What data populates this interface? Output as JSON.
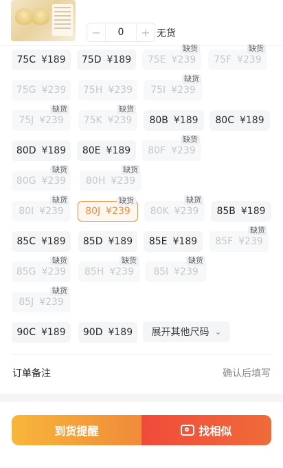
{
  "product": {
    "thumbnail_alt": "product image"
  },
  "quantity": {
    "minus": "−",
    "value": "0",
    "plus": "+",
    "stock_status": "无货"
  },
  "sizes": [
    {
      "size": "75C",
      "price": "¥189",
      "oos": false
    },
    {
      "size": "75D",
      "price": "¥189",
      "oos": false
    },
    {
      "size": "75E",
      "price": "¥239",
      "oos": true,
      "tag": "缺货"
    },
    {
      "size": "75F",
      "price": "¥239",
      "oos": true,
      "tag": "缺货"
    },
    {
      "size": "75G",
      "price": "¥239",
      "oos": true
    },
    {
      "size": "75H",
      "price": "¥239",
      "oos": true
    },
    {
      "size": "75I",
      "price": "¥239",
      "oos": true,
      "tag": "缺货"
    },
    {
      "size": "75J",
      "price": "¥239",
      "oos": true,
      "tag": "缺货"
    },
    {
      "size": "75K",
      "price": "¥239",
      "oos": true,
      "tag": "缺货"
    },
    {
      "size": "80B",
      "price": "¥189",
      "oos": false
    },
    {
      "size": "80C",
      "price": "¥189",
      "oos": false
    },
    {
      "size": "80D",
      "price": "¥189",
      "oos": false
    },
    {
      "size": "80E",
      "price": "¥189",
      "oos": false
    },
    {
      "size": "80F",
      "price": "¥239",
      "oos": true,
      "tag": "缺货"
    },
    {
      "size": "80G",
      "price": "¥239",
      "oos": true,
      "tag": "缺货"
    },
    {
      "size": "80H",
      "price": "¥239",
      "oos": true,
      "tag": "缺货"
    },
    {
      "size": "80I",
      "price": "¥239",
      "oos": true,
      "tag": "缺货"
    },
    {
      "size": "80J",
      "price": "¥239",
      "oos": true,
      "tag": "缺货",
      "selected": true
    },
    {
      "size": "80K",
      "price": "¥239",
      "oos": true,
      "tag": "缺货"
    },
    {
      "size": "85B",
      "price": "¥189",
      "oos": false
    },
    {
      "size": "85C",
      "price": "¥189",
      "oos": false
    },
    {
      "size": "85D",
      "price": "¥189",
      "oos": false
    },
    {
      "size": "85E",
      "price": "¥189",
      "oos": false
    },
    {
      "size": "85F",
      "price": "¥239",
      "oos": true,
      "tag": "缺货"
    },
    {
      "size": "85G",
      "price": "¥239",
      "oos": true,
      "tag": "缺货"
    },
    {
      "size": "85H",
      "price": "¥239",
      "oos": true,
      "tag": "缺货"
    },
    {
      "size": "85I",
      "price": "¥239",
      "oos": true,
      "tag": "缺货"
    },
    {
      "size": "85J",
      "price": "¥239",
      "oos": true,
      "tag": "缺货"
    },
    {
      "size": "90C",
      "price": "¥189",
      "oos": false
    },
    {
      "size": "90D",
      "price": "¥189",
      "oos": false
    }
  ],
  "expand_label": "展开其他尺码",
  "order_note": {
    "label": "订单备注",
    "hint": "确认后填写"
  },
  "actions": {
    "notify": "到货提醒",
    "similar": "找相似"
  }
}
